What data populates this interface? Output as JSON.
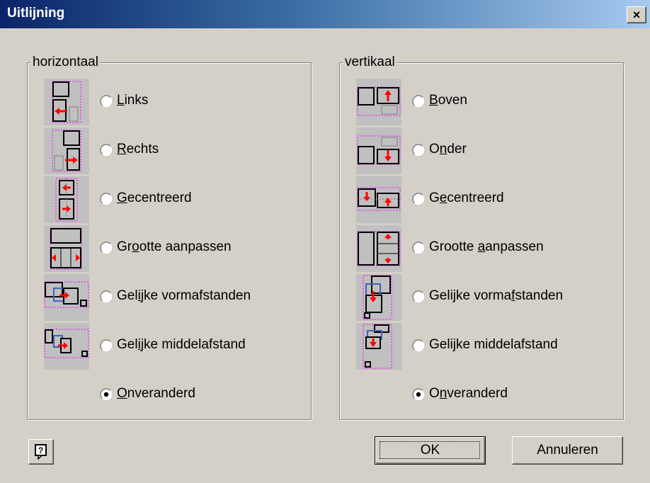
{
  "window": {
    "title": "Uitlijning",
    "close_label": "×"
  },
  "horizontal": {
    "title": "horizontaal",
    "options": [
      {
        "pre": "",
        "mn": "L",
        "post": "inks",
        "icon": "align-left-icon",
        "selected": false
      },
      {
        "pre": "",
        "mn": "R",
        "post": "echts",
        "icon": "align-right-icon",
        "selected": false
      },
      {
        "pre": "",
        "mn": "G",
        "post": "ecentreerd",
        "icon": "align-center-horizontal-icon",
        "selected": false
      },
      {
        "pre": "Gr",
        "mn": "o",
        "post": "otte aanpassen",
        "icon": "fit-width-icon",
        "selected": false
      },
      {
        "pre": "Gel",
        "mn": "i",
        "post": "jke vormafstanden",
        "icon": "equal-shape-spacing-horizontal-icon",
        "selected": false
      },
      {
        "pre": "Gel",
        "mn": "i",
        "post": "jke middelafstand",
        "icon": "equal-center-spacing-horizontal-icon",
        "selected": false
      },
      {
        "pre": "",
        "mn": "O",
        "post": "nveranderd",
        "icon": "",
        "selected": true
      }
    ]
  },
  "vertical": {
    "title": "vertikaal",
    "options": [
      {
        "pre": "",
        "mn": "B",
        "post": "oven",
        "icon": "align-top-icon",
        "selected": false
      },
      {
        "pre": "O",
        "mn": "n",
        "post": "der",
        "icon": "align-bottom-icon",
        "selected": false
      },
      {
        "pre": "G",
        "mn": "e",
        "post": "centreerd",
        "icon": "align-center-vertical-icon",
        "selected": false
      },
      {
        "pre": "Grootte ",
        "mn": "a",
        "post": "anpassen",
        "icon": "fit-height-icon",
        "selected": false
      },
      {
        "pre": "Gelijke vorma",
        "mn": "f",
        "post": "standen",
        "icon": "equal-shape-spacing-vertical-icon",
        "selected": false
      },
      {
        "pre": "Gelijke middelafstand",
        "mn": "",
        "post": "",
        "icon": "equal-center-spacing-vertical-icon",
        "selected": false
      },
      {
        "pre": "O",
        "mn": "n",
        "post": "veranderd",
        "icon": "",
        "selected": true
      }
    ]
  },
  "buttons": {
    "ok": "OK",
    "cancel": "Annuleren",
    "help_icon": "help-icon"
  },
  "colors": {
    "title_start": "#0a246a",
    "title_end": "#a6caf0",
    "face": "#d4d0c8",
    "icon_bg": "#c0c0c0",
    "arrow": "#ff0000",
    "bounds": "#ff00ff"
  }
}
